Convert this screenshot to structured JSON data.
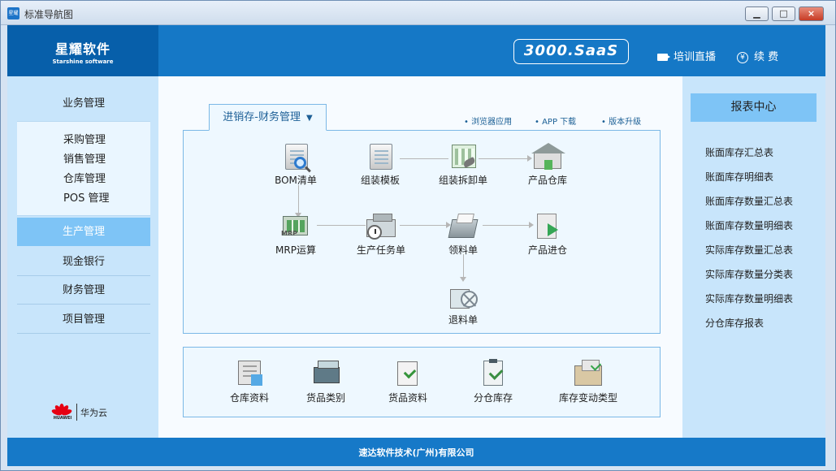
{
  "window": {
    "title": "标准导航图",
    "app_icon_text": "星耀"
  },
  "brand": {
    "cn": "星耀软件",
    "en": "Starshine software"
  },
  "header": {
    "saas_label": "3000.SaaS",
    "live_label": "培训直播",
    "renew_label": "续 费"
  },
  "left_nav": {
    "business": "业务管理",
    "sub_items": [
      "采购管理",
      "销售管理",
      "仓库管理",
      "POS 管理"
    ],
    "production": "生产管理",
    "cash": "现金银行",
    "finance": "财务管理",
    "project": "项目管理",
    "partner_logo": {
      "brand": "HUAWEI",
      "text": "华为云"
    }
  },
  "center": {
    "tab_label": "进销存-财务管理",
    "tab_arrow": "▼",
    "links": {
      "browser": "浏览器应用",
      "app": "APP 下载",
      "upgrade": "版本升级"
    },
    "flow_nodes": {
      "bom": "BOM清单",
      "assembly_template": "组装模板",
      "assembly_disassembly": "组装拆卸单",
      "product_warehouse": "产品仓库",
      "mrp": "MRP运算",
      "production_task": "生产任务单",
      "material_issue": "领料单",
      "product_inbound": "产品进仓",
      "material_return": "退料单"
    },
    "bottom_items": [
      "仓库资料",
      "货品类别",
      "货品资料",
      "分仓库存",
      "库存变动类型"
    ]
  },
  "right_panel": {
    "title": "报表中心",
    "items": [
      "账面库存汇总表",
      "账面库存明细表",
      "账面库存数量汇总表",
      "账面库存数量明细表",
      "实际库存数量汇总表",
      "实际库存数量分类表",
      "实际库存数量明细表",
      "分仓库存报表"
    ]
  },
  "footer": {
    "company": "速达软件技术(广州)有限公司"
  }
}
